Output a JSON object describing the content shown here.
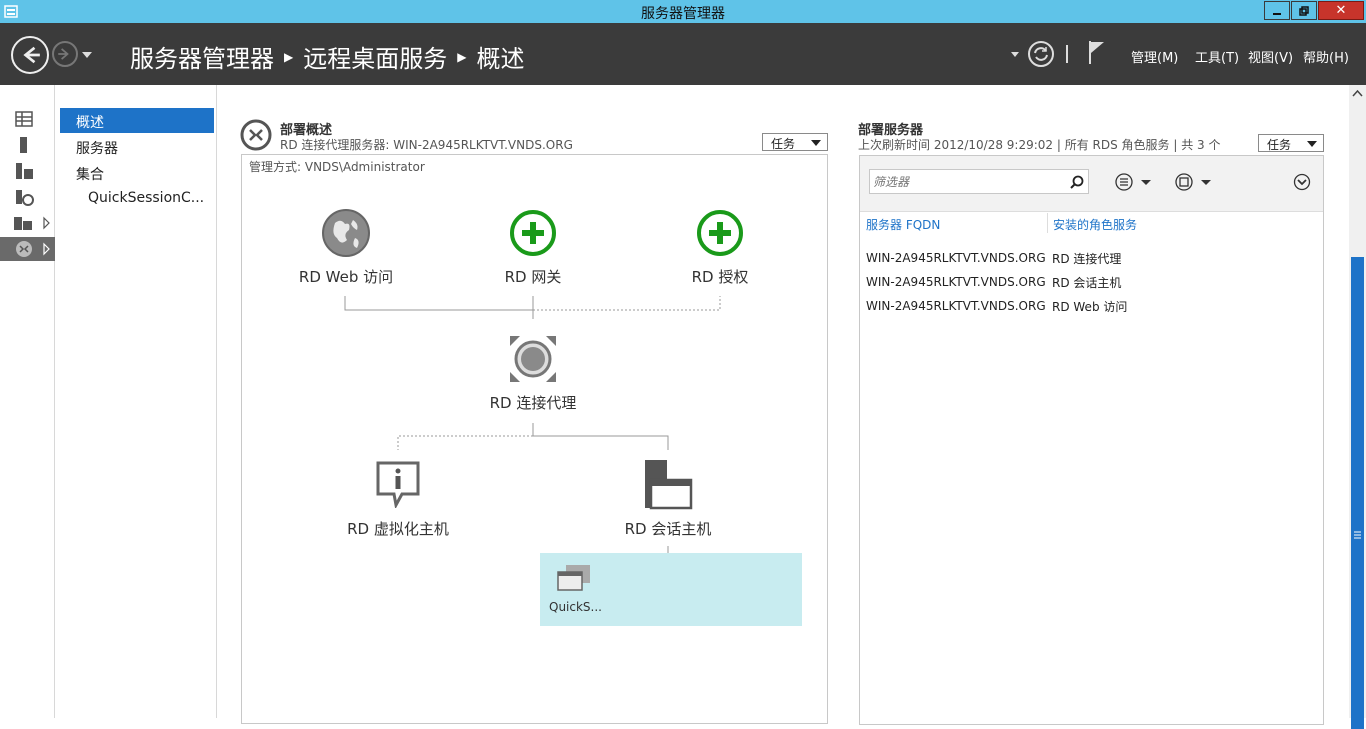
{
  "window": {
    "title": "服务器管理器"
  },
  "header": {
    "breadcrumbs": [
      "服务器管理器",
      "远程桌面服务",
      "概述"
    ],
    "menus": [
      "管理(M)",
      "工具(T)",
      "视图(V)",
      "帮助(H)"
    ]
  },
  "subnav": {
    "items": [
      "概述",
      "服务器",
      "集合",
      "QuickSessionC..."
    ]
  },
  "overview": {
    "title": "部署概述",
    "subtitle": "RD 连接代理服务器: WIN-2A945RLKTVT.VNDS.ORG",
    "tasks_label": "任务",
    "managed_by": "管理方式: VNDS\\Administrator",
    "nodes": {
      "web_access": "RD Web 访问",
      "gateway": "RD 网关",
      "licensing": "RD 授权",
      "broker": "RD 连接代理",
      "virtualization": "RD 虚拟化主机",
      "session_host": "RD 会话主机"
    },
    "collection": "QuickS..."
  },
  "servers": {
    "title": "部署服务器",
    "subtitle": "上次刷新时间 2012/10/28 9:29:02 | 所有 RDS 角色服务 | 共 3 个",
    "tasks_label": "任务",
    "filter_placeholder": "筛选器",
    "columns": [
      "服务器 FQDN",
      "安装的角色服务"
    ],
    "rows": [
      [
        "WIN-2A945RLKTVT.VNDS.ORG",
        "RD 连接代理"
      ],
      [
        "WIN-2A945RLKTVT.VNDS.ORG",
        "RD 会话主机"
      ],
      [
        "WIN-2A945RLKTVT.VNDS.ORG",
        "RD Web 访问"
      ]
    ]
  },
  "colors": {
    "titlebar": "#5fc3e8",
    "header": "#3b3b3b",
    "accent": "#1e73c8",
    "add_green": "#1a9a1a",
    "collection_bg": "#c8ecf0"
  }
}
